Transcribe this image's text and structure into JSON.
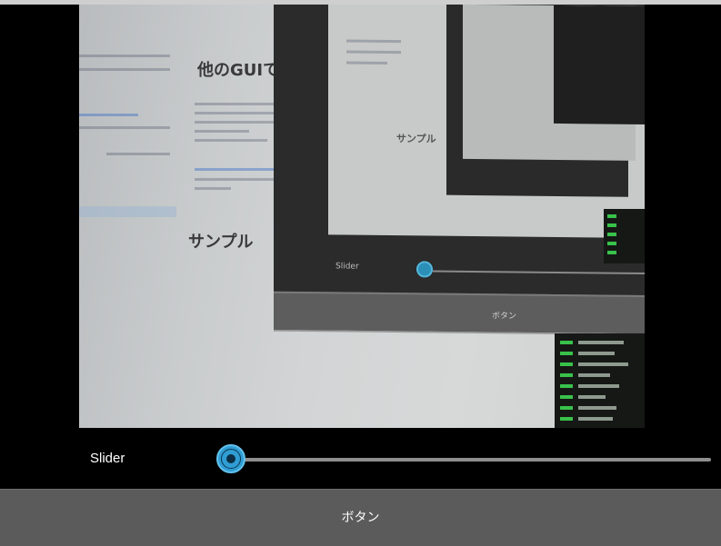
{
  "preview": {
    "photo_heading_1": "他のGUIで",
    "photo_heading_2": "サンプル",
    "photo_heading_3": "サンプル",
    "monitor_slider_label": "Slider",
    "monitor_button_label": "ボタン"
  },
  "slider": {
    "label": "Slider",
    "value_fraction": 0.0,
    "accent_color": "#2f9ed4"
  },
  "button": {
    "label": "ボタン"
  }
}
